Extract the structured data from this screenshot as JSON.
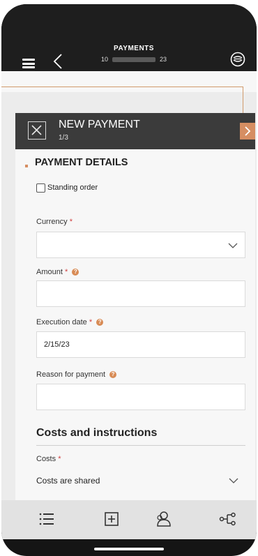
{
  "header": {
    "title": "PAYMENTS",
    "account_prefix": "10",
    "account_suffix": "23"
  },
  "card": {
    "title": "NEW PAYMENT",
    "step": "1/3"
  },
  "section": {
    "title": "PAYMENT DETAILS"
  },
  "form": {
    "standing_order_label": "Standing order",
    "standing_order_checked": false,
    "currency": {
      "label": "Currency",
      "required": "*",
      "value": ""
    },
    "amount": {
      "label": "Amount",
      "required": "*",
      "value": ""
    },
    "execution_date": {
      "label": "Execution date",
      "required": "*",
      "value": "2/15/23"
    },
    "reason": {
      "label": "Reason for payment",
      "value": ""
    }
  },
  "costs_section": {
    "title": "Costs and instructions",
    "costs": {
      "label": "Costs",
      "required": "*",
      "value": "Costs are shared"
    }
  },
  "icons": {
    "menu": "menu-icon",
    "back": "back-icon",
    "logo": "bank-logo-icon",
    "close": "close-icon",
    "next": "chevron-right-icon",
    "help": "help-icon",
    "nav_list": "list-icon",
    "nav_add": "add-icon",
    "nav_contacts": "contacts-icon",
    "nav_share": "share-icon"
  },
  "colors": {
    "accent": "#d68e62",
    "header_bg": "#1e1e1e",
    "card_header_bg": "#3b3b3b",
    "required": "#d04040"
  }
}
